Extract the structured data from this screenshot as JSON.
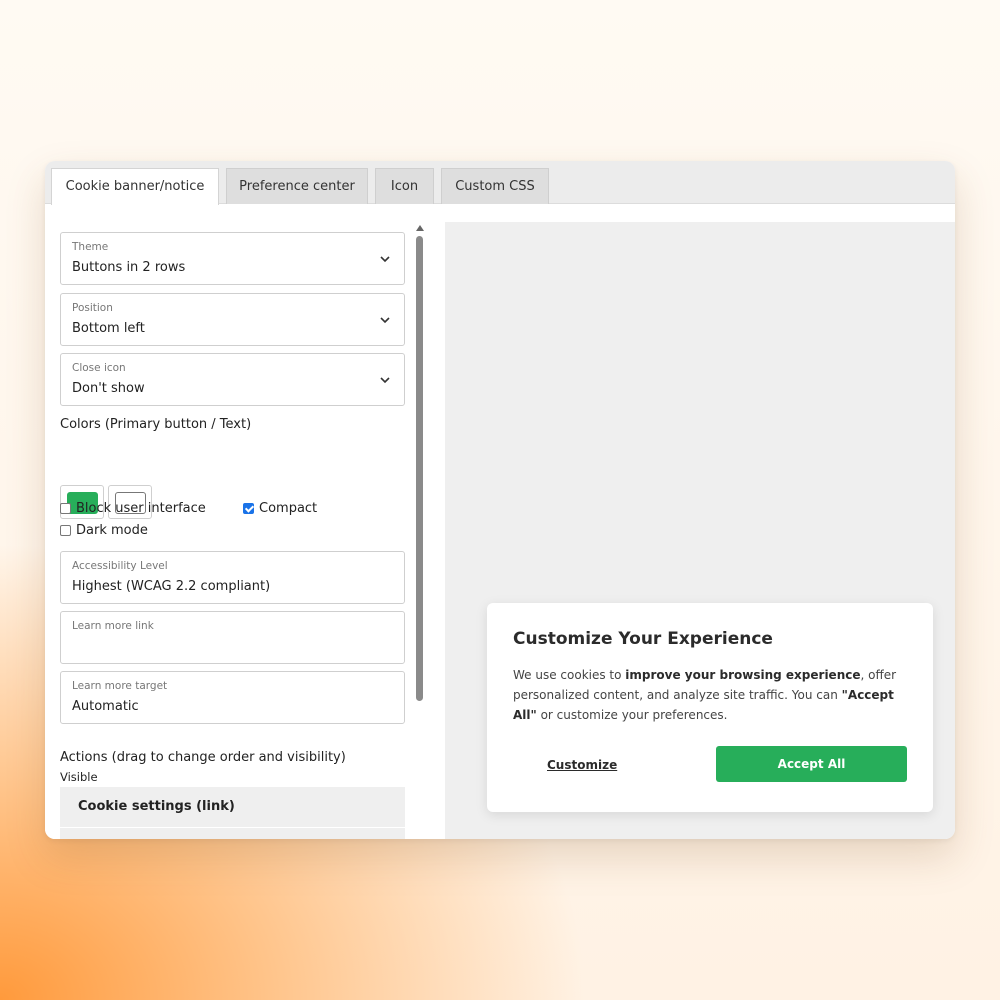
{
  "tabs": [
    {
      "label": "Cookie banner/notice",
      "active": true
    },
    {
      "label": "Preference center",
      "active": false
    },
    {
      "label": "Icon",
      "active": false
    },
    {
      "label": "Custom CSS",
      "active": false
    }
  ],
  "settings": {
    "theme": {
      "label": "Theme",
      "value": "Buttons in 2 rows"
    },
    "position": {
      "label": "Position",
      "value": "Bottom left"
    },
    "close_icon": {
      "label": "Close icon",
      "value": "Don't show"
    },
    "colors_label": "Colors (Primary button / Text)",
    "primary_color": "#27ae5a",
    "text_color": "#ffffff",
    "block_ui": {
      "label": "Block user interface",
      "checked": false
    },
    "compact": {
      "label": "Compact",
      "checked": true
    },
    "dark_mode": {
      "label": "Dark mode",
      "checked": false
    },
    "accessibility": {
      "label": "Accessibility Level",
      "value": "Highest (WCAG 2.2 compliant)"
    },
    "learn_more_link": {
      "label": "Learn more link",
      "value": ""
    },
    "learn_more_target": {
      "label": "Learn more target",
      "value": "Automatic"
    },
    "actions_label": "Actions (drag to change order and visibility)",
    "visible_label": "Visible",
    "actions": [
      "Cookie settings (link)",
      ""
    ]
  },
  "banner": {
    "title": "Customize Your Experience",
    "text_1": "We use cookies to ",
    "text_bold_1": "improve your browsing experience",
    "text_2": ", offer personalized content, and analyze site traffic. You can ",
    "text_bold_2": "\"Accept All\"",
    "text_3": " or customize your preferences.",
    "customize_label": "Customize",
    "accept_label": "Accept All"
  }
}
